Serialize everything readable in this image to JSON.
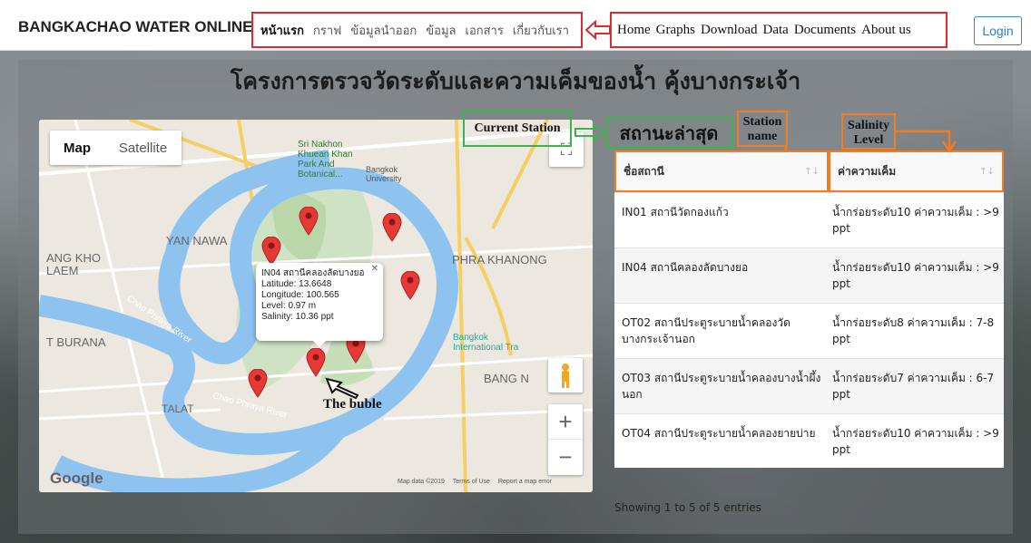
{
  "navbar": {
    "brand": "BANGKACHAO WATER ONLINE",
    "thai_links": [
      "หน้าแรก",
      "กราฟ",
      "ข้อมูลนำออก",
      "ข้อมูล",
      "เอกสาร",
      "เกี่ยวกับเรา"
    ],
    "english_links": [
      "Home",
      "Graphs",
      "Download",
      "Data",
      "Documents",
      "About us"
    ],
    "login_label": "Login"
  },
  "page_title": "โครงการตรวจวัดระดับและความเค็มของน้ำ คุ้งบางกระเจ้า",
  "map": {
    "toggle_map": "Map",
    "toggle_satellite": "Satellite",
    "places": [
      "Sri Nakhon Khuean Khan Park And Botanical...",
      "Bangkok University",
      "YAN NAWA",
      "ANG KHO LAEM",
      "PHRA KHANONG",
      "T BURANA",
      "Bangkok International Tra",
      "BANG N",
      "TALAT",
      "Chao Phraya River",
      "Chao Phraya River"
    ],
    "infowindow": {
      "name": "IN04 สถานีคลองลัดบางยอ",
      "latitude": "Latitude: 13.6648",
      "longitude": "Longitude: 100.565",
      "level": "Level: 0.97 m",
      "salinity": "Salinity: 10.36 ppt"
    },
    "bubble_annotation": "The buble",
    "google": "Google",
    "footer": [
      "Map data ©2019",
      "Terms of Use",
      "Report a map error"
    ],
    "zoom_in": "+",
    "zoom_out": "−"
  },
  "annotations": {
    "current_station": "Current Station",
    "status_heading": "สถานะล่าสุด",
    "station_name": "Station name",
    "salinity_level": "Salinity Level"
  },
  "table": {
    "columns": [
      "ชื่อสถานี",
      "ค่าความเค็ม"
    ],
    "rows": [
      {
        "station": "IN01 สถานีวัดกองแก้ว",
        "value": "น้ำกร่อยระดับ10 ค่าความเค็ม : >9 ppt"
      },
      {
        "station": "IN04 สถานีคลองลัดบางยอ",
        "value": "น้ำกร่อยระดับ10 ค่าความเค็ม : >9 ppt"
      },
      {
        "station": "OT02 สถานีประตูระบายน้ำคลองวัดบางกระเจ้านอก",
        "value": "น้ำกร่อยระดับ8 ค่าความเค็ม : 7-8 ppt"
      },
      {
        "station": "OT03 สถานีประตูระบายน้ำคลองบางน้ำผึ้งนอก",
        "value": "น้ำกร่อยระดับ7 ค่าความเค็ม : 6-7 ppt"
      },
      {
        "station": "OT04 สถานีประตูระบายน้ำคลองยายบ่าย",
        "value": "น้ำกร่อยระดับ10 ค่าความเค็ม : >9 ppt"
      }
    ],
    "info": "Showing 1 to 5 of 5 entries"
  },
  "colors": {
    "red_annotation": "#e1282e",
    "green_annotation": "#39b54a",
    "orange_annotation": "#f07c23",
    "river": "#8ec3f0",
    "pin": "#e53935"
  }
}
